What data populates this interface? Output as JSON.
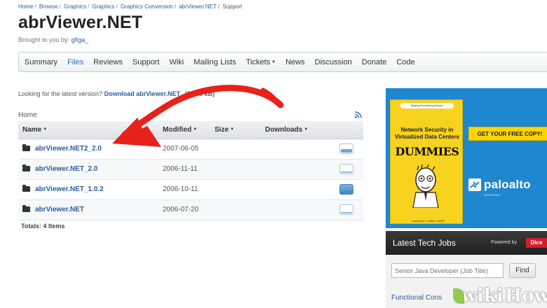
{
  "breadcrumb": [
    "Home",
    "Browse",
    "Graphics",
    "Graphics",
    "Graphics Conversion",
    "abrViewer.NET",
    "Support"
  ],
  "breadcrumb_separator": "/",
  "project": {
    "title": "abrViewer.NET",
    "byline_prefix": "Brought to you by:",
    "byline_user": "gfiga_"
  },
  "tabs": [
    {
      "label": "Summary",
      "active": false
    },
    {
      "label": "Files",
      "active": true
    },
    {
      "label": "Reviews",
      "active": false
    },
    {
      "label": "Support",
      "active": false
    },
    {
      "label": "Wiki",
      "active": false
    },
    {
      "label": "Mailing Lists",
      "active": false
    },
    {
      "label": "Tickets",
      "active": false,
      "dropdown": true
    },
    {
      "label": "News",
      "active": false
    },
    {
      "label": "Discussion",
      "active": false
    },
    {
      "label": "Donate",
      "active": false
    },
    {
      "label": "Code",
      "active": false
    }
  ],
  "latest": {
    "prefix": "Looking for the latest version?",
    "link": "Download abrViewer.NET",
    "size": "(124.0 kB)"
  },
  "files": {
    "location": "Home",
    "columns": {
      "name": "Name",
      "modified": "Modified",
      "size": "Size",
      "downloads": "Downloads"
    },
    "rows": [
      {
        "name": "abrViewer.NET2_2.0",
        "modified": "2007-06-05",
        "size": "",
        "downloads": "",
        "bar": "filled"
      },
      {
        "name": "abrViewer.NET_2.0",
        "modified": "2006-11-11",
        "size": "",
        "downloads": "",
        "bar": "line"
      },
      {
        "name": "abrViewer.NET_1.0.2",
        "modified": "2006-10-11",
        "size": "",
        "downloads": "",
        "bar": "filled"
      },
      {
        "name": "abrViewer.NET",
        "modified": "2006-07-20",
        "size": "",
        "downloads": "",
        "bar": "line"
      }
    ],
    "totals": "Totals: 4 Items"
  },
  "ad": {
    "book_top": "Making Everything Easier!",
    "book_title": "Network Security in Virtualized Data Centers",
    "book_brand": "DUMMIES",
    "cta": "GET YOUR FREE COPY!",
    "sponsor": "paloalto",
    "sponsor_sub": "NETWORKS",
    "author": "Lawrence C. Miller, CISSP"
  },
  "jobs": {
    "title": "Latest Tech Jobs",
    "powered_by": "Powered by",
    "dice": "Dice",
    "search_placeholder": "Senior Java Developer (Job Title)",
    "find_label": "Find",
    "first_job": "Functional Cons"
  },
  "watermark": {
    "wiki": "wiki",
    "how": "How"
  },
  "colors": {
    "link": "#2a5d9c",
    "accent_red": "#e8211b",
    "ad_blue": "#1e87d0",
    "book_yellow": "#f7d21e"
  }
}
